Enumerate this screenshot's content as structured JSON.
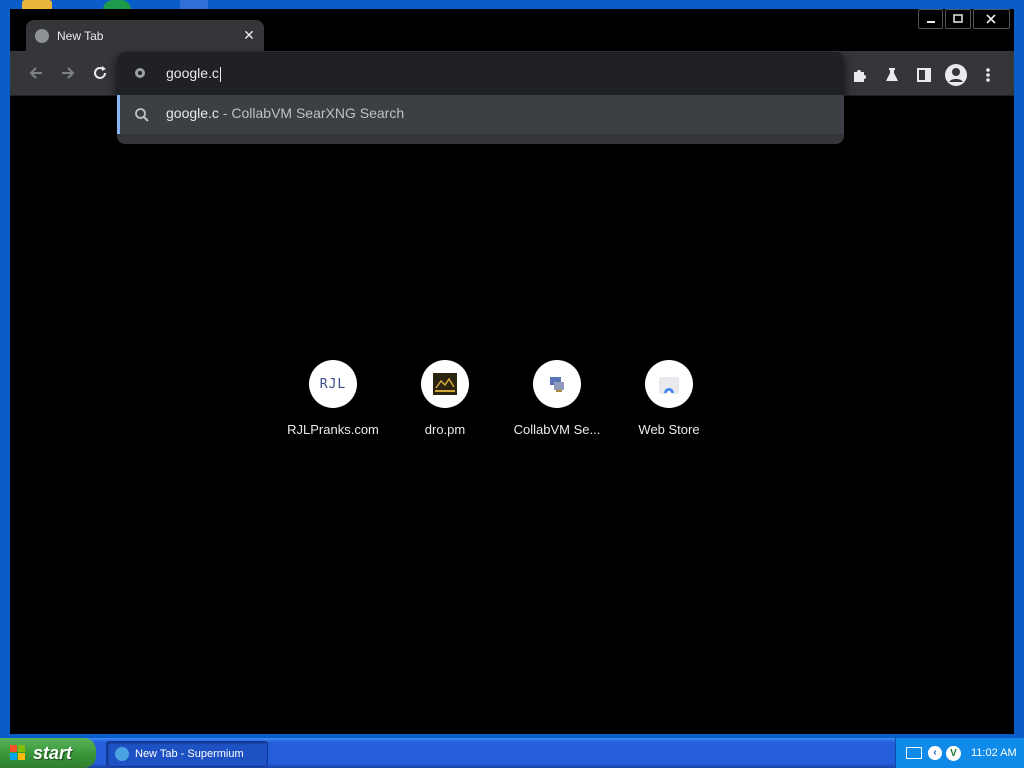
{
  "browser": {
    "tab_title": "New Tab",
    "tab_close": "✕",
    "window_controls": {
      "minimize": "▁",
      "maximize": "▢",
      "close": "✕"
    },
    "omnibox": {
      "typed_text": "google.c",
      "suggestion_query": "google.c",
      "suggestion_rest": " - CollabVM SearXNG Search"
    }
  },
  "shortcuts": [
    {
      "label": "RJLPranks.com",
      "icon_text": "RJL"
    },
    {
      "label": "dro.pm"
    },
    {
      "label": "CollabVM Se..."
    },
    {
      "label": "Web Store"
    }
  ],
  "taskbar": {
    "start_label": "start",
    "task_label": "New Tab - Supermium",
    "clock": "11:02 AM"
  },
  "colors": {
    "accent": "#8ab4f8",
    "toolbar_bg": "#35363a",
    "taskbar_blue": "#245edb",
    "start_green": "#3a9a3a"
  }
}
